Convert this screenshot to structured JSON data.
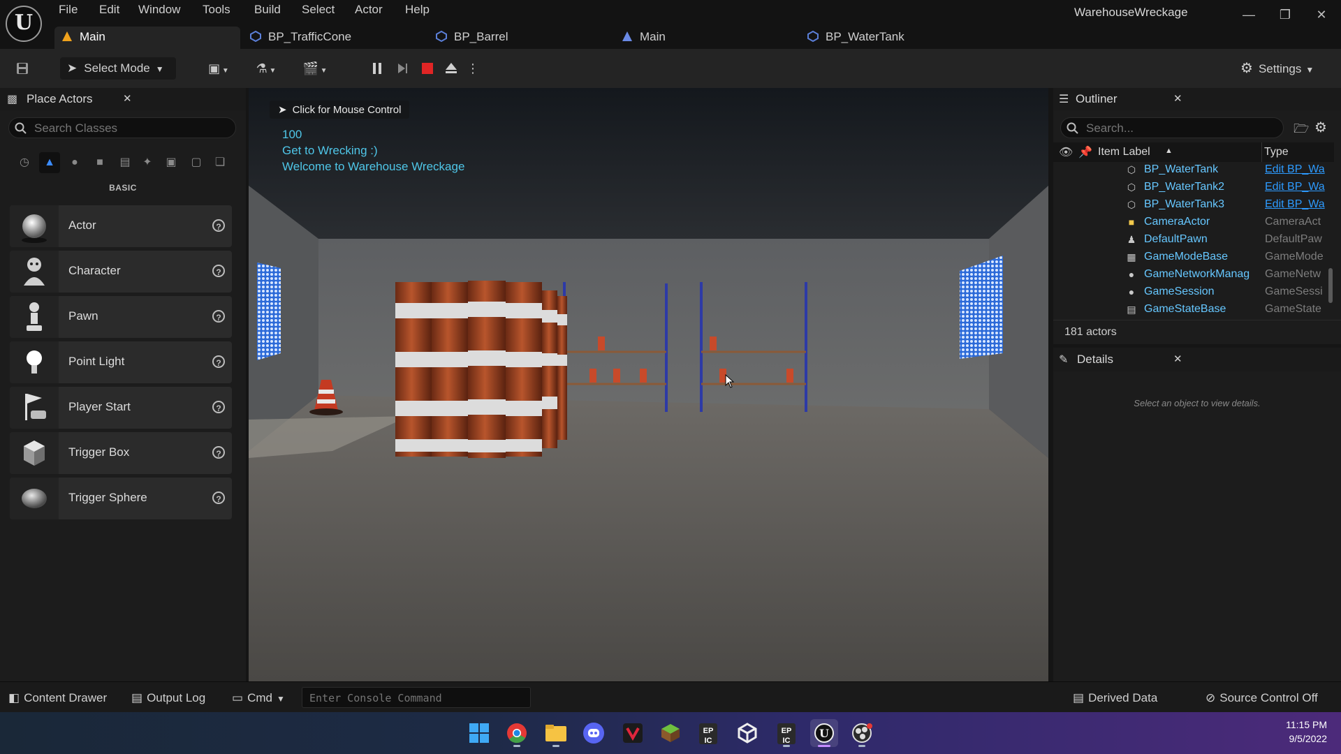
{
  "window": {
    "project_title": "WarehouseWreckage",
    "logo": "U"
  },
  "menu": [
    "File",
    "Edit",
    "Window",
    "Tools",
    "Build",
    "Select",
    "Actor",
    "Help"
  ],
  "tabs": [
    {
      "label": "Main",
      "icon": "level-icon",
      "active": true
    },
    {
      "label": "BP_TrafficCone",
      "icon": "blueprint-icon"
    },
    {
      "label": "BP_Barrel",
      "icon": "blueprint-icon"
    },
    {
      "label": "Main",
      "icon": "level-icon"
    },
    {
      "label": "BP_WaterTank",
      "icon": "blueprint-icon"
    }
  ],
  "toolbar": {
    "mode_label": "Select Mode",
    "settings_label": "Settings"
  },
  "place_actors": {
    "title": "Place Actors",
    "search_placeholder": "Search Classes",
    "category": "BASIC",
    "items": [
      {
        "label": "Actor",
        "icon": "actor-sphere-icon"
      },
      {
        "label": "Character",
        "icon": "character-icon"
      },
      {
        "label": "Pawn",
        "icon": "pawn-icon"
      },
      {
        "label": "Point Light",
        "icon": "point-light-icon"
      },
      {
        "label": "Player Start",
        "icon": "player-start-icon"
      },
      {
        "label": "Trigger Box",
        "icon": "trigger-box-icon"
      },
      {
        "label": "Trigger Sphere",
        "icon": "trigger-sphere-icon"
      }
    ]
  },
  "viewport": {
    "mouse_control": "Click for Mouse Control",
    "debug_lines": [
      "100",
      "Get to Wrecking :)",
      "Welcome to Warehouse Wreckage"
    ]
  },
  "outliner": {
    "title": "Outliner",
    "search_placeholder": "Search...",
    "col_label": "Item Label",
    "col_type": "Type",
    "rows": [
      {
        "name": "BP_WaterTank",
        "type": "Edit BP_Wa",
        "link": true,
        "icon": "blueprint-icon"
      },
      {
        "name": "BP_WaterTank2",
        "type": "Edit BP_Wa",
        "link": true,
        "icon": "blueprint-icon"
      },
      {
        "name": "BP_WaterTank3",
        "type": "Edit BP_Wa",
        "link": true,
        "icon": "blueprint-icon"
      },
      {
        "name": "CameraActor",
        "type": "CameraAct",
        "link": false,
        "icon": "camera-icon"
      },
      {
        "name": "DefaultPawn",
        "type": "DefaultPaw",
        "link": false,
        "icon": "pawn-icon"
      },
      {
        "name": "GameModeBase",
        "type": "GameMode",
        "link": false,
        "icon": "gamemode-icon"
      },
      {
        "name": "GameNetworkManag",
        "type": "GameNetw",
        "link": false,
        "icon": "network-icon"
      },
      {
        "name": "GameSession",
        "type": "GameSessi",
        "link": false,
        "icon": "session-icon"
      },
      {
        "name": "GameStateBase",
        "type": "GameState",
        "link": false,
        "icon": "gamestate-icon"
      }
    ],
    "actor_count": "181 actors"
  },
  "details": {
    "title": "Details",
    "empty_text": "Select an object to view details."
  },
  "statusbar": {
    "content_drawer": "Content Drawer",
    "output_log": "Output Log",
    "cmd": "Cmd",
    "console_placeholder": "Enter Console Command",
    "derived_data": "Derived Data",
    "source_control": "Source Control Off"
  },
  "taskbar": {
    "apps": [
      "windows-start-icon",
      "chrome-icon",
      "file-explorer-icon",
      "discord-icon",
      "vivaldi-icon",
      "minecraft-icon",
      "epic-games-icon",
      "unity-icon",
      "epic-games-icon",
      "unreal-engine-icon",
      "obs-icon"
    ],
    "time": "11:15 PM",
    "date": "9/5/2022"
  }
}
